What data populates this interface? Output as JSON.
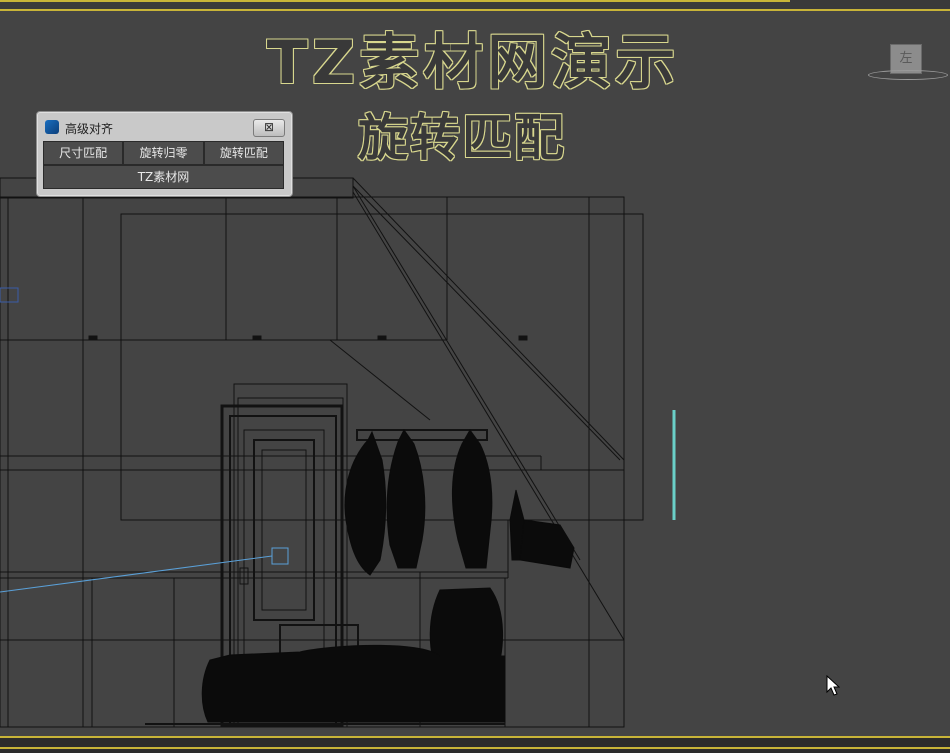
{
  "banner": {
    "title": "TZ素材网演示",
    "subtitle": "旋转匹配"
  },
  "viewcube": {
    "face_label": "左"
  },
  "dialog": {
    "title": "高级对齐",
    "close_symbol": "⊠",
    "buttons": [
      "尺寸匹配",
      "旋转归零",
      "旋转匹配"
    ],
    "wide_button": "TZ素材网"
  },
  "colors": {
    "viewport_bg": "#444444",
    "frame_accent": "#c8b438",
    "wire": "#111111",
    "selection": "#5aa0d8",
    "gizmo": "#6ad0c8"
  },
  "icons": {
    "app": "app-logo-icon",
    "close": "close-icon",
    "cursor": "mouse-pointer-icon"
  }
}
